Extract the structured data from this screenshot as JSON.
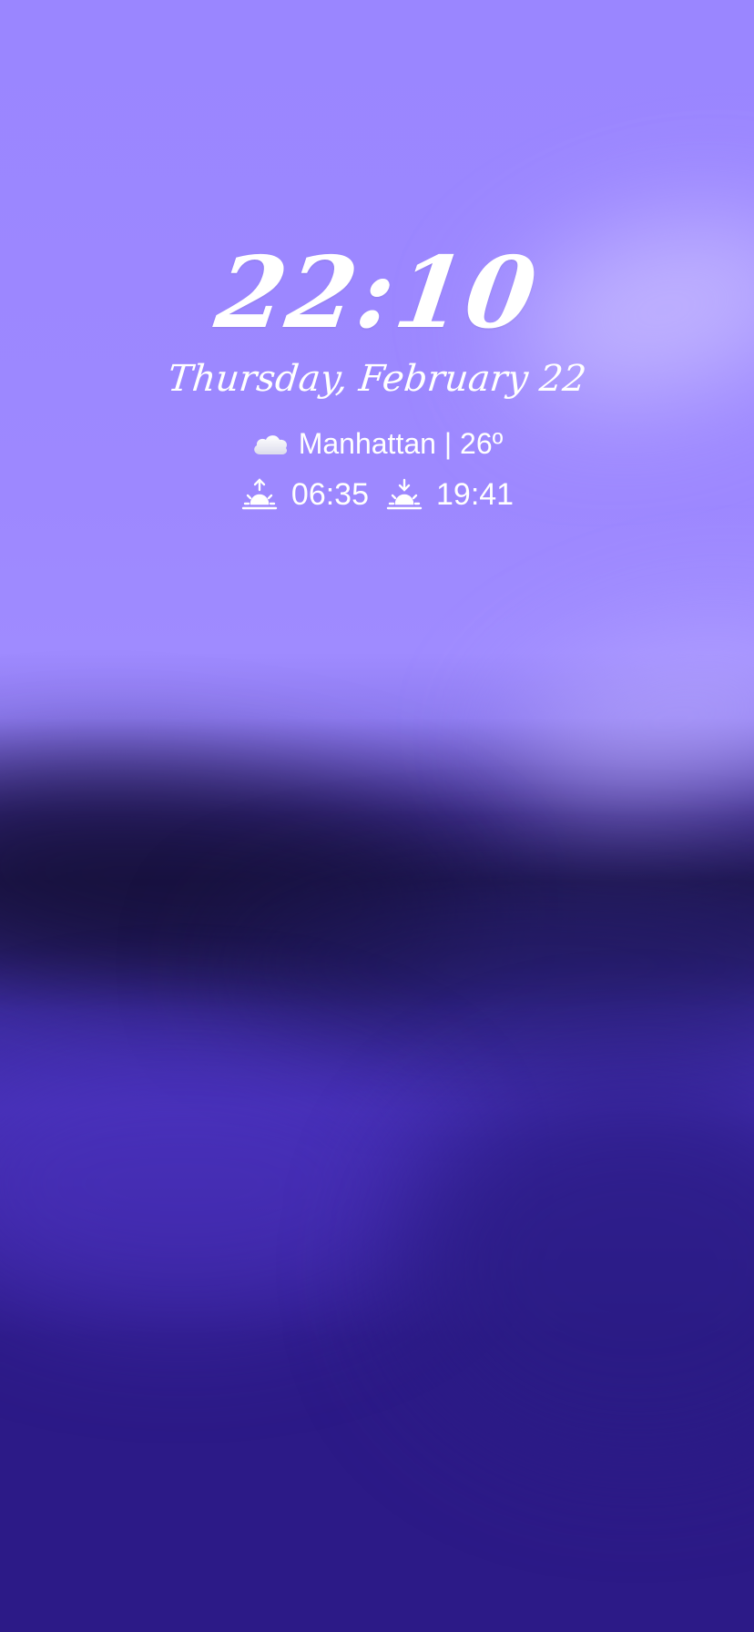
{
  "lockscreen": {
    "time": "22:10",
    "date": "Thursday, February 22",
    "weather": {
      "icon": "cloud-icon",
      "text": "Manhattan | 26º"
    },
    "sunrise": {
      "icon": "sunrise-icon",
      "time": "06:35"
    },
    "sunset": {
      "icon": "sunset-icon",
      "time": "19:41"
    }
  },
  "colors": {
    "sky_light": "#9a86ff",
    "horizon_dark": "#1e1650",
    "deep_purple": "#2c1a87",
    "text": "#ffffff"
  }
}
